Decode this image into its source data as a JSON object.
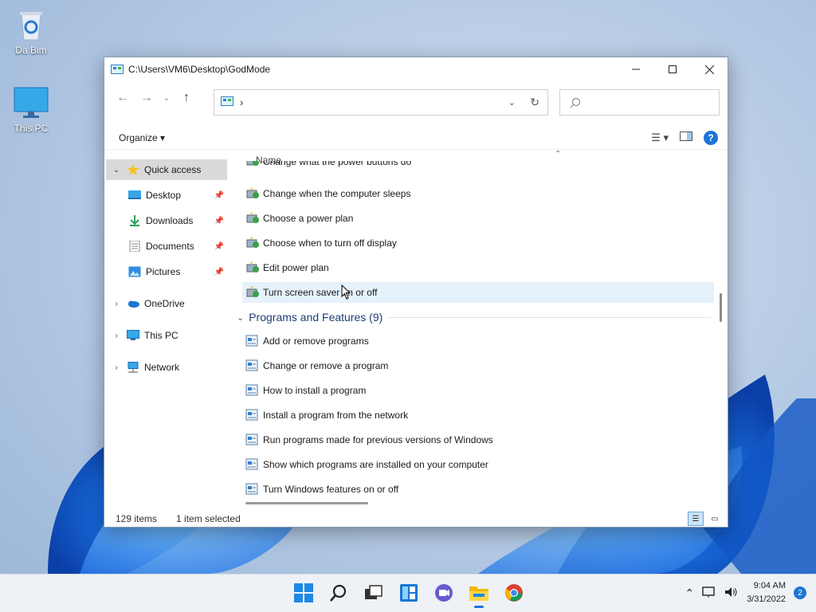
{
  "desktop": {
    "icons": [
      {
        "label": "Da Bim"
      },
      {
        "label": "This PC"
      }
    ]
  },
  "window": {
    "title": "C:\\Users\\VM6\\Desktop\\GodMode",
    "address_chevron": "›",
    "search_placeholder": "",
    "organize_label": "Organize ▾",
    "column_name": "Name",
    "help_label": "?"
  },
  "nav_pane": {
    "items": [
      {
        "label": "Quick access"
      },
      {
        "label": "Desktop"
      },
      {
        "label": "Downloads"
      },
      {
        "label": "Documents"
      },
      {
        "label": "Pictures"
      },
      {
        "label": "OneDrive"
      },
      {
        "label": "This PC"
      },
      {
        "label": "Network"
      }
    ]
  },
  "content": {
    "power_items": [
      "Change what the power buttons do",
      "Change when the computer sleeps",
      "Choose a power plan",
      "Choose when to turn off display",
      "Edit power plan",
      "Turn screen saver on or off"
    ],
    "group_header": "Programs and Features (9)",
    "program_items": [
      "Add or remove programs",
      "Change or remove a program",
      "How to install a program",
      "Install a program from the network",
      "Run programs made for previous versions of Windows",
      "Show which programs are installed on your computer",
      "Turn Windows features on or off"
    ]
  },
  "status": {
    "item_count": "129 items",
    "selected": "1 item selected"
  },
  "taskbar": {
    "time": "9:04 AM",
    "date": "3/31/2022",
    "notification_count": "2"
  },
  "colors": {
    "accent": "#1e74d8",
    "group_header": "#1e3d74",
    "selection": "#e5f1fb"
  }
}
